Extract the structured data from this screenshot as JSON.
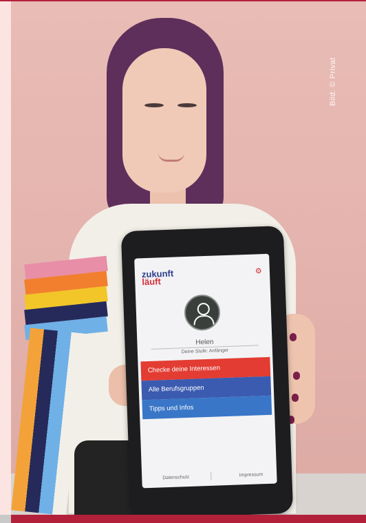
{
  "photo": {
    "credit": "Bild: © Privat"
  },
  "app": {
    "logo_line1": "zukunft",
    "logo_line2": "läuft",
    "settings_icon": "gear-icon",
    "avatar_icon": "user-avatar-icon",
    "user_name": "Helen",
    "user_level": "Deine Stufe: Anfänger",
    "menu": [
      {
        "label": "Checke deine Interessen",
        "color": "#e33c33"
      },
      {
        "label": "Alle Berufsgruppen",
        "color": "#3b5bb1"
      },
      {
        "label": "Tipps und Infos",
        "color": "#3a76c7"
      }
    ],
    "footer": {
      "left": "Datenschutz",
      "right": "Impressum"
    }
  },
  "colors": {
    "accent_red": "#b3203a",
    "wall": "#e6b7b1"
  }
}
